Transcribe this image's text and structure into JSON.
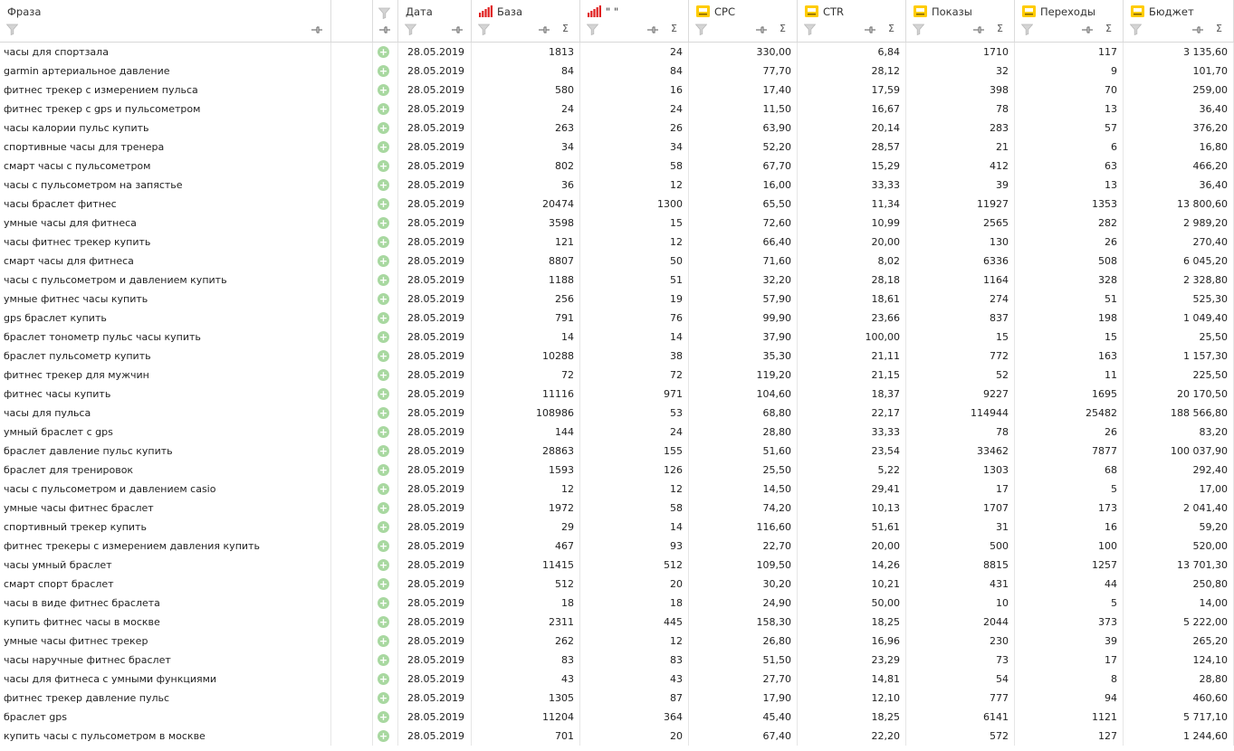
{
  "columns": {
    "phrase": "Фраза",
    "date": "Дата",
    "base": "База",
    "quoted": "\" \"",
    "cpc": "CPC",
    "ctr": "CTR",
    "shows": "Показы",
    "clicks": "Переходы",
    "budget": "Бюджет"
  },
  "sigma": "Σ",
  "add_glyph": "+",
  "colors": {
    "bars_icon": "#e02020",
    "yandex_icon_bg": "#ffcc00",
    "add_button": "#a8d8a0",
    "grid_border": "#dcdcdc"
  },
  "icons": [
    "filter-icon",
    "pin-icon",
    "bar-chart-icon",
    "yandex-icon",
    "add-icon"
  ],
  "rows": [
    {
      "phrase": "часы для спортзала",
      "date": "28.05.2019",
      "base": "1813",
      "quoted": "24",
      "cpc": "330,00",
      "ctr": "6,84",
      "shows": "1710",
      "clicks": "117",
      "budget": "3 135,60"
    },
    {
      "phrase": "garmin артериальное давление",
      "date": "28.05.2019",
      "base": "84",
      "quoted": "84",
      "cpc": "77,70",
      "ctr": "28,12",
      "shows": "32",
      "clicks": "9",
      "budget": "101,70"
    },
    {
      "phrase": "фитнес трекер с измерением пульса",
      "date": "28.05.2019",
      "base": "580",
      "quoted": "16",
      "cpc": "17,40",
      "ctr": "17,59",
      "shows": "398",
      "clicks": "70",
      "budget": "259,00"
    },
    {
      "phrase": "фитнес трекер с gps и пульсометром",
      "date": "28.05.2019",
      "base": "24",
      "quoted": "24",
      "cpc": "11,50",
      "ctr": "16,67",
      "shows": "78",
      "clicks": "13",
      "budget": "36,40"
    },
    {
      "phrase": "часы калории пульс купить",
      "date": "28.05.2019",
      "base": "263",
      "quoted": "26",
      "cpc": "63,90",
      "ctr": "20,14",
      "shows": "283",
      "clicks": "57",
      "budget": "376,20"
    },
    {
      "phrase": "спортивные часы для тренера",
      "date": "28.05.2019",
      "base": "34",
      "quoted": "34",
      "cpc": "52,20",
      "ctr": "28,57",
      "shows": "21",
      "clicks": "6",
      "budget": "16,80"
    },
    {
      "phrase": "смарт часы с пульсометром",
      "date": "28.05.2019",
      "base": "802",
      "quoted": "58",
      "cpc": "67,70",
      "ctr": "15,29",
      "shows": "412",
      "clicks": "63",
      "budget": "466,20"
    },
    {
      "phrase": "часы с пульсометром на запястье",
      "date": "28.05.2019",
      "base": "36",
      "quoted": "12",
      "cpc": "16,00",
      "ctr": "33,33",
      "shows": "39",
      "clicks": "13",
      "budget": "36,40"
    },
    {
      "phrase": "часы браслет фитнес",
      "date": "28.05.2019",
      "base": "20474",
      "quoted": "1300",
      "cpc": "65,50",
      "ctr": "11,34",
      "shows": "11927",
      "clicks": "1353",
      "budget": "13 800,60"
    },
    {
      "phrase": "умные часы для фитнеса",
      "date": "28.05.2019",
      "base": "3598",
      "quoted": "15",
      "cpc": "72,60",
      "ctr": "10,99",
      "shows": "2565",
      "clicks": "282",
      "budget": "2 989,20"
    },
    {
      "phrase": "часы фитнес трекер купить",
      "date": "28.05.2019",
      "base": "121",
      "quoted": "12",
      "cpc": "66,40",
      "ctr": "20,00",
      "shows": "130",
      "clicks": "26",
      "budget": "270,40"
    },
    {
      "phrase": "смарт часы для фитнеса",
      "date": "28.05.2019",
      "base": "8807",
      "quoted": "50",
      "cpc": "71,60",
      "ctr": "8,02",
      "shows": "6336",
      "clicks": "508",
      "budget": "6 045,20"
    },
    {
      "phrase": "часы с пульсометром и давлением купить",
      "date": "28.05.2019",
      "base": "1188",
      "quoted": "51",
      "cpc": "32,20",
      "ctr": "28,18",
      "shows": "1164",
      "clicks": "328",
      "budget": "2 328,80"
    },
    {
      "phrase": "умные фитнес часы купить",
      "date": "28.05.2019",
      "base": "256",
      "quoted": "19",
      "cpc": "57,90",
      "ctr": "18,61",
      "shows": "274",
      "clicks": "51",
      "budget": "525,30"
    },
    {
      "phrase": "gps браслет купить",
      "date": "28.05.2019",
      "base": "791",
      "quoted": "76",
      "cpc": "99,90",
      "ctr": "23,66",
      "shows": "837",
      "clicks": "198",
      "budget": "1 049,40"
    },
    {
      "phrase": "браслет тонометр пульс часы купить",
      "date": "28.05.2019",
      "base": "14",
      "quoted": "14",
      "cpc": "37,90",
      "ctr": "100,00",
      "shows": "15",
      "clicks": "15",
      "budget": "25,50"
    },
    {
      "phrase": "браслет пульсометр купить",
      "date": "28.05.2019",
      "base": "10288",
      "quoted": "38",
      "cpc": "35,30",
      "ctr": "21,11",
      "shows": "772",
      "clicks": "163",
      "budget": "1 157,30"
    },
    {
      "phrase": "фитнес трекер для мужчин",
      "date": "28.05.2019",
      "base": "72",
      "quoted": "72",
      "cpc": "119,20",
      "ctr": "21,15",
      "shows": "52",
      "clicks": "11",
      "budget": "225,50"
    },
    {
      "phrase": "фитнес часы купить",
      "date": "28.05.2019",
      "base": "11116",
      "quoted": "971",
      "cpc": "104,60",
      "ctr": "18,37",
      "shows": "9227",
      "clicks": "1695",
      "budget": "20 170,50"
    },
    {
      "phrase": "часы для пульса",
      "date": "28.05.2019",
      "base": "108986",
      "quoted": "53",
      "cpc": "68,80",
      "ctr": "22,17",
      "shows": "114944",
      "clicks": "25482",
      "budget": "188 566,80"
    },
    {
      "phrase": "умный браслет с gps",
      "date": "28.05.2019",
      "base": "144",
      "quoted": "24",
      "cpc": "28,80",
      "ctr": "33,33",
      "shows": "78",
      "clicks": "26",
      "budget": "83,20"
    },
    {
      "phrase": "браслет давление пульс купить",
      "date": "28.05.2019",
      "base": "28863",
      "quoted": "155",
      "cpc": "51,60",
      "ctr": "23,54",
      "shows": "33462",
      "clicks": "7877",
      "budget": "100 037,90"
    },
    {
      "phrase": "браслет для тренировок",
      "date": "28.05.2019",
      "base": "1593",
      "quoted": "126",
      "cpc": "25,50",
      "ctr": "5,22",
      "shows": "1303",
      "clicks": "68",
      "budget": "292,40"
    },
    {
      "phrase": "часы с пульсометром и давлением casio",
      "date": "28.05.2019",
      "base": "12",
      "quoted": "12",
      "cpc": "14,50",
      "ctr": "29,41",
      "shows": "17",
      "clicks": "5",
      "budget": "17,00"
    },
    {
      "phrase": "умные часы фитнес браслет",
      "date": "28.05.2019",
      "base": "1972",
      "quoted": "58",
      "cpc": "74,20",
      "ctr": "10,13",
      "shows": "1707",
      "clicks": "173",
      "budget": "2 041,40"
    },
    {
      "phrase": "спортивный трекер купить",
      "date": "28.05.2019",
      "base": "29",
      "quoted": "14",
      "cpc": "116,60",
      "ctr": "51,61",
      "shows": "31",
      "clicks": "16",
      "budget": "59,20"
    },
    {
      "phrase": "фитнес трекеры с измерением давления купить",
      "date": "28.05.2019",
      "base": "467",
      "quoted": "93",
      "cpc": "22,70",
      "ctr": "20,00",
      "shows": "500",
      "clicks": "100",
      "budget": "520,00"
    },
    {
      "phrase": "часы умный браслет",
      "date": "28.05.2019",
      "base": "11415",
      "quoted": "512",
      "cpc": "109,50",
      "ctr": "14,26",
      "shows": "8815",
      "clicks": "1257",
      "budget": "13 701,30"
    },
    {
      "phrase": "смарт спорт браслет",
      "date": "28.05.2019",
      "base": "512",
      "quoted": "20",
      "cpc": "30,20",
      "ctr": "10,21",
      "shows": "431",
      "clicks": "44",
      "budget": "250,80"
    },
    {
      "phrase": "часы в виде фитнес браслета",
      "date": "28.05.2019",
      "base": "18",
      "quoted": "18",
      "cpc": "24,90",
      "ctr": "50,00",
      "shows": "10",
      "clicks": "5",
      "budget": "14,00"
    },
    {
      "phrase": "купить фитнес часы в москве",
      "date": "28.05.2019",
      "base": "2311",
      "quoted": "445",
      "cpc": "158,30",
      "ctr": "18,25",
      "shows": "2044",
      "clicks": "373",
      "budget": "5 222,00"
    },
    {
      "phrase": "умные часы фитнес трекер",
      "date": "28.05.2019",
      "base": "262",
      "quoted": "12",
      "cpc": "26,80",
      "ctr": "16,96",
      "shows": "230",
      "clicks": "39",
      "budget": "265,20"
    },
    {
      "phrase": "часы наручные фитнес браслет",
      "date": "28.05.2019",
      "base": "83",
      "quoted": "83",
      "cpc": "51,50",
      "ctr": "23,29",
      "shows": "73",
      "clicks": "17",
      "budget": "124,10"
    },
    {
      "phrase": "часы для фитнеса с умными функциями",
      "date": "28.05.2019",
      "base": "43",
      "quoted": "43",
      "cpc": "27,70",
      "ctr": "14,81",
      "shows": "54",
      "clicks": "8",
      "budget": "28,80"
    },
    {
      "phrase": "фитнес трекер давление пульс",
      "date": "28.05.2019",
      "base": "1305",
      "quoted": "87",
      "cpc": "17,90",
      "ctr": "12,10",
      "shows": "777",
      "clicks": "94",
      "budget": "460,60"
    },
    {
      "phrase": "браслет gps",
      "date": "28.05.2019",
      "base": "11204",
      "quoted": "364",
      "cpc": "45,40",
      "ctr": "18,25",
      "shows": "6141",
      "clicks": "1121",
      "budget": "5 717,10"
    },
    {
      "phrase": "купить часы с пульсометром в москве",
      "date": "28.05.2019",
      "base": "701",
      "quoted": "20",
      "cpc": "67,40",
      "ctr": "22,20",
      "shows": "572",
      "clicks": "127",
      "budget": "1 244,60"
    }
  ]
}
